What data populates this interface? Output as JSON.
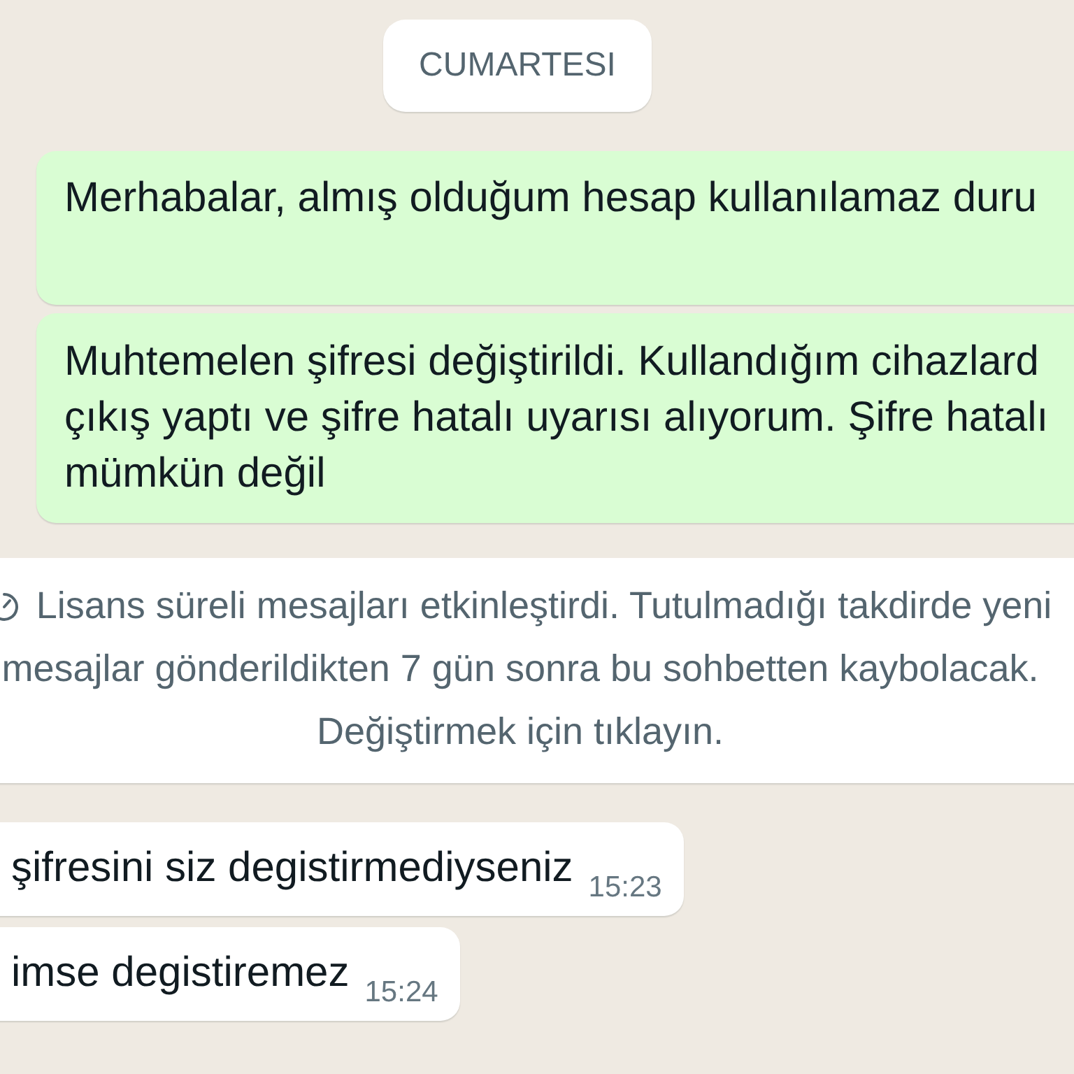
{
  "date_divider": {
    "label": "CUMARTESI"
  },
  "messages": [
    {
      "kind": "outgoing",
      "lines": [
        "Merhabalar, almış olduğum hesap kullanılamaz duru"
      ]
    },
    {
      "kind": "outgoing",
      "lines": [
        "Muhtemelen şifresi değiştirildi. Kullandığım cihazlard",
        "çıkış yaptı ve şifre hatalı uyarısı alıyorum. Şifre hatalı",
        "mümkün değil"
      ]
    },
    {
      "kind": "system",
      "lines": [
        "Lisans süreli mesajları etkinleştirdi. Tutulmadığı takdirde yeni",
        "mesajlar gönderildikten 7 gün sonra bu sohbetten kaybolacak.",
        "Değiştirmek için tıklayın."
      ]
    },
    {
      "kind": "incoming",
      "lines": [
        "şifresini siz degistirmediyseniz"
      ],
      "time": "15:23"
    },
    {
      "kind": "incoming",
      "lines": [
        "imse degistiremez"
      ],
      "time": "15:24"
    }
  ]
}
